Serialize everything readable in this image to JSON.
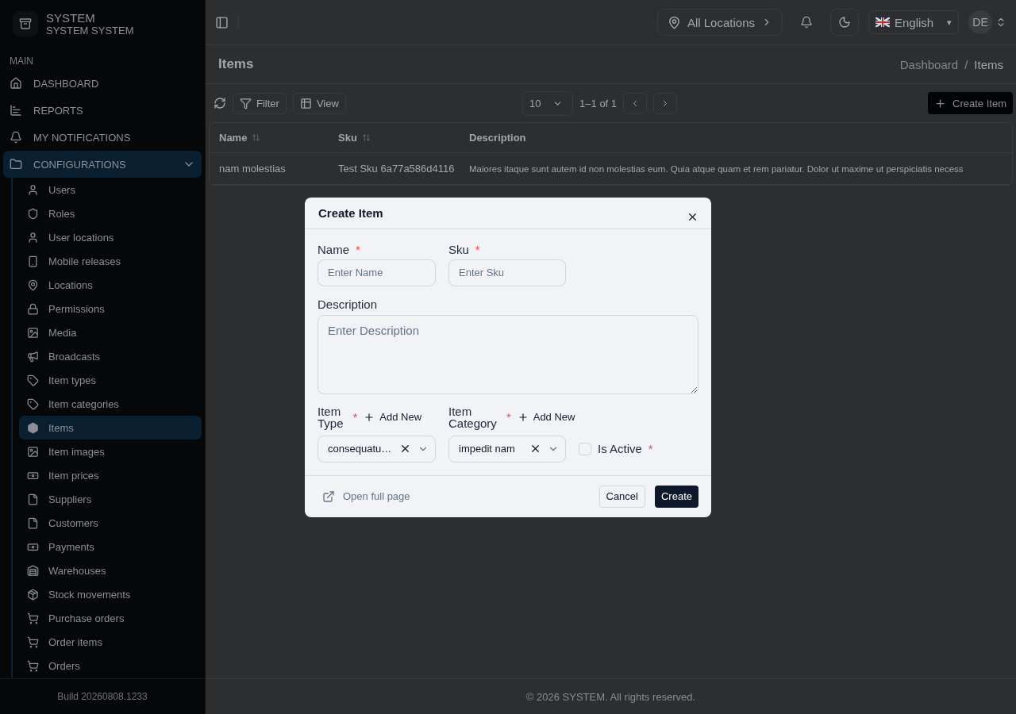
{
  "sidebar": {
    "brand": {
      "title": "SYSTEM",
      "subtitle": "SYSTEM SYSTEM"
    },
    "section": "MAIN",
    "items": [
      {
        "label": "DASHBOARD",
        "selected": false
      },
      {
        "label": "REPORTS",
        "selected": false
      },
      {
        "label": "MY NOTIFICATIONS",
        "selected": false
      },
      {
        "label": "CONFIGURATIONS",
        "selected": true,
        "expanded": true,
        "children": [
          {
            "label": "Users",
            "selected": false
          },
          {
            "label": "Roles",
            "selected": false
          },
          {
            "label": "User locations",
            "selected": false
          },
          {
            "label": "Mobile releases",
            "selected": false
          },
          {
            "label": "Locations",
            "selected": false
          },
          {
            "label": "Permissions",
            "selected": false
          },
          {
            "label": "Media",
            "selected": false
          },
          {
            "label": "Broadcasts",
            "selected": false
          },
          {
            "label": "Item types",
            "selected": false
          },
          {
            "label": "Item categories",
            "selected": false
          },
          {
            "label": "Items",
            "selected": true
          },
          {
            "label": "Item images",
            "selected": false
          },
          {
            "label": "Item prices",
            "selected": false
          },
          {
            "label": "Suppliers",
            "selected": false
          },
          {
            "label": "Customers",
            "selected": false
          },
          {
            "label": "Payments",
            "selected": false
          },
          {
            "label": "Warehouses",
            "selected": false
          },
          {
            "label": "Stock movements",
            "selected": false
          },
          {
            "label": "Purchase orders",
            "selected": false
          },
          {
            "label": "Order items",
            "selected": false
          },
          {
            "label": "Orders",
            "selected": false
          }
        ]
      }
    ],
    "build": "Build 20260808.1233"
  },
  "header": {
    "location": "All Locations",
    "language": "English",
    "language_caret": "▾",
    "avatar": "DE"
  },
  "page": {
    "title": "Items",
    "breadcrumb": [
      "Dashboard",
      "Items"
    ],
    "breadcrumb_separator": "/"
  },
  "toolbar": {
    "filter": "Filter",
    "view": "View",
    "page_size": "10",
    "range": "1–1 of 1",
    "create": "Create Item"
  },
  "table": {
    "columns": [
      {
        "label": "Name",
        "sortable": true
      },
      {
        "label": "Sku",
        "sortable": true
      },
      {
        "label": "Description",
        "sortable": false
      }
    ],
    "rows": [
      [
        "nam molestias",
        "Test Sku 6a77a586d4116",
        "Maiores itaque sunt autem id non molestias eum. Quia atque quam et rem pariatur. Dolor ut maxime ut perspiciatis necess"
      ]
    ]
  },
  "footer": "© 2026 SYSTEM. All rights reserved.",
  "dialog": {
    "title": "Create Item",
    "fields": [
      {
        "label": "Name",
        "placeholder": "Enter Name",
        "required_mark": "*"
      },
      {
        "label": "Sku",
        "placeholder": "Enter Sku",
        "required_mark": "*"
      }
    ],
    "description": {
      "label": "Description",
      "placeholder": "Enter Description"
    },
    "selects": [
      {
        "label": "Item Type",
        "value": "consequatu…",
        "required_mark": "*",
        "add": "Add New"
      },
      {
        "label": "Item Category",
        "value": "impedit nam",
        "required_mark": "*",
        "add": "Add New"
      }
    ],
    "active": {
      "label": "Is Active",
      "checked": false,
      "required_mark": "*"
    },
    "open_full": "Open full page",
    "cancel": "Cancel",
    "create": "Create"
  }
}
